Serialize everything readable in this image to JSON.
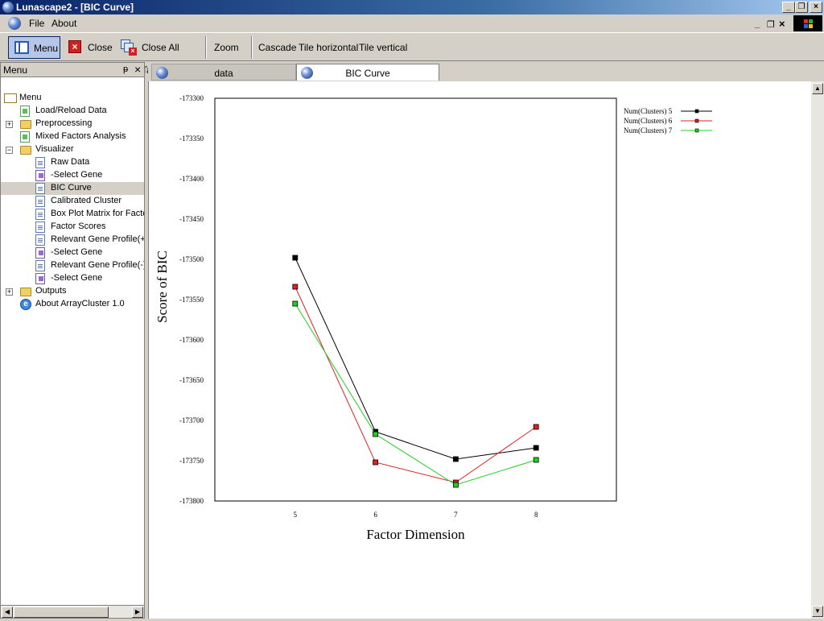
{
  "window": {
    "title": "Lunascape2 - [BIC Curve]"
  },
  "menubar": {
    "items": [
      {
        "label": "File"
      },
      {
        "label": "About"
      }
    ]
  },
  "toolbar": {
    "menu_label": "Menu",
    "close_label": "Close",
    "close_all_label": "Close All Tabs",
    "zoom_label": "Zoom",
    "cascade_label": "Cascade",
    "tile_horizontal_label": "Tile horizontal",
    "tile_vertical_label": "Tile vertical"
  },
  "panel": {
    "title": "Menu"
  },
  "tree": [
    {
      "label": "Menu",
      "level": 0,
      "icon": "root-icon",
      "expander": ""
    },
    {
      "label": "Load/Reload Data",
      "level": 1,
      "icon": "doc-green-icon",
      "expander": ""
    },
    {
      "label": "Preprocessing",
      "level": 1,
      "icon": "folder-icon",
      "expander": "+"
    },
    {
      "label": "Mixed Factors Analysis",
      "level": 1,
      "icon": "doc-green-icon",
      "expander": ""
    },
    {
      "label": "Visualizer",
      "level": 1,
      "icon": "folder-icon",
      "expander": "−"
    },
    {
      "label": "Raw Data",
      "level": 2,
      "icon": "doc-icon",
      "expander": ""
    },
    {
      "label": "-Select Gene",
      "level": 2,
      "icon": "doc-purple-icon",
      "expander": ""
    },
    {
      "label": "BIC Curve",
      "level": 2,
      "icon": "doc-icon",
      "expander": "",
      "selected": true
    },
    {
      "label": "Calibrated Cluster",
      "level": 2,
      "icon": "doc-icon",
      "expander": ""
    },
    {
      "label": "Box Plot Matrix for Facto",
      "level": 2,
      "icon": "doc-icon",
      "expander": ""
    },
    {
      "label": "Factor Scores",
      "level": 2,
      "icon": "doc-icon",
      "expander": ""
    },
    {
      "label": "Relevant Gene Profile(+",
      "level": 2,
      "icon": "doc-icon",
      "expander": ""
    },
    {
      "label": "-Select Gene",
      "level": 2,
      "icon": "doc-purple-icon",
      "expander": ""
    },
    {
      "label": "Relevant Gene Profile(-)",
      "level": 2,
      "icon": "doc-icon",
      "expander": ""
    },
    {
      "label": "-Select Gene",
      "level": 2,
      "icon": "doc-purple-icon",
      "expander": ""
    },
    {
      "label": "Outputs",
      "level": 1,
      "icon": "folder-icon",
      "expander": "+"
    },
    {
      "label": "About ArrayCluster 1.0",
      "level": 1,
      "icon": "ie-icon",
      "expander": ""
    }
  ],
  "tabs": [
    {
      "label": "data",
      "active": false
    },
    {
      "label": "BIC Curve",
      "active": true
    }
  ],
  "chart_data": {
    "type": "line",
    "title": "",
    "xlabel": "Factor Dimension",
    "ylabel": "Score of BIC",
    "x": [
      5,
      6,
      7,
      8
    ],
    "xlim": [
      4,
      9
    ],
    "ylim": [
      -173800,
      -173300
    ],
    "yticks": [
      -173300,
      -173350,
      -173400,
      -173450,
      -173500,
      -173550,
      -173600,
      -173650,
      -173700,
      -173750,
      -173800
    ],
    "xticks": [
      5,
      6,
      7,
      8
    ],
    "grid": false,
    "legend": "top-right outside",
    "series": [
      {
        "name": "Num(Clusters) 5",
        "color": "#000000",
        "values": [
          -173498,
          -173714,
          -173748,
          -173734
        ]
      },
      {
        "name": "Num(Clusters) 6",
        "color": "#e02020",
        "values": [
          -173534,
          -173752,
          -173777,
          -173708
        ]
      },
      {
        "name": "Num(Clusters) 7",
        "color": "#20d020",
        "values": [
          -173555,
          -173717,
          -173780,
          -173749
        ]
      }
    ]
  }
}
